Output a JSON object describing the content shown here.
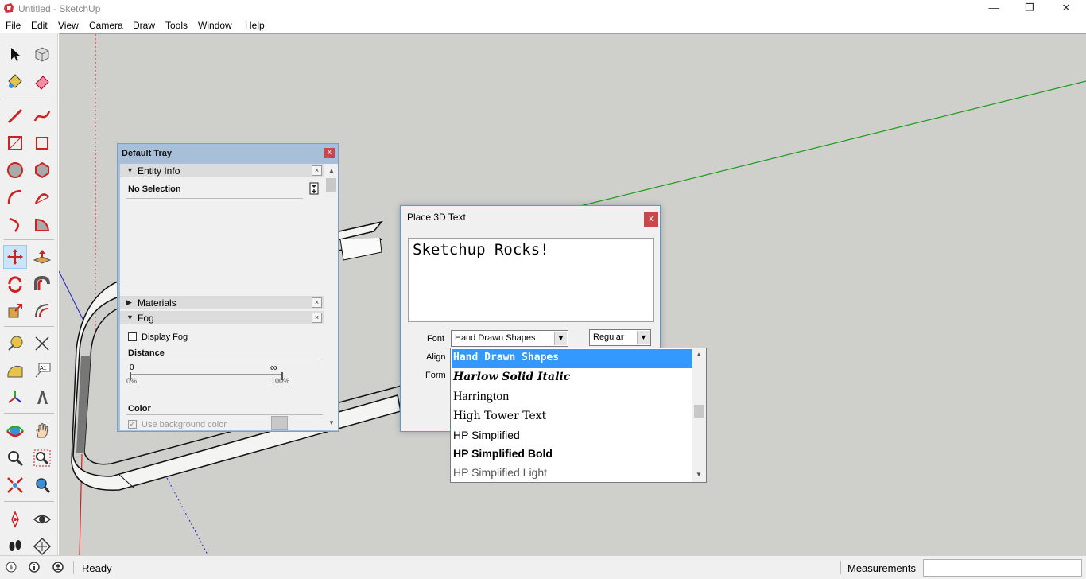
{
  "window": {
    "title": "Untitled - SketchUp",
    "minimize": "—",
    "restore": "❐",
    "close": "✕"
  },
  "menu": [
    "File",
    "Edit",
    "View",
    "Camera",
    "Draw",
    "Tools",
    "Window",
    "Help"
  ],
  "toolbar": {
    "tools": [
      "select",
      "make-component",
      "paint-bucket",
      "eraser",
      "line",
      "freehand",
      "rectangle",
      "rotated-rectangle",
      "circle",
      "polygon",
      "arc",
      "2-point-arc",
      "3-point-arc",
      "pie",
      "move",
      "push-pull",
      "rotate",
      "follow-me",
      "scale",
      "offset",
      "tape-measure",
      "dimension",
      "protractor",
      "text",
      "axes",
      "3d-text",
      "orbit",
      "pan",
      "zoom",
      "zoom-window",
      "zoom-extents",
      "previous-view",
      "position-camera",
      "look-around",
      "walk",
      "section-plane"
    ],
    "active": "move"
  },
  "tray": {
    "title": "Default Tray",
    "close": "x",
    "entity_info": {
      "label": "Entity Info",
      "selection": "No Selection"
    },
    "materials": {
      "label": "Materials"
    },
    "fog": {
      "label": "Fog",
      "display_fog": "Display Fog",
      "display_fog_checked": false,
      "distance_label": "Distance",
      "slider_start": "0",
      "slider_end": "∞",
      "pct_start": "0%",
      "pct_end": "100%",
      "color_label": "Color",
      "use_bg_color": "Use background color",
      "use_bg_color_checked": true
    },
    "collapse_arrow": "▼",
    "expand_arrow": "▶",
    "section_close": "×"
  },
  "dialog": {
    "title": "Place 3D Text",
    "close": "x",
    "text": "Sketchup Rocks!",
    "font_label": "Font",
    "font_value": "Hand Drawn Shapes",
    "style_value": "Regular",
    "align_label": "Align",
    "form_label": "Form"
  },
  "font_list": [
    "Hand Drawn Shapes",
    "Harlow Solid Italic",
    "Harrington",
    "High Tower Text",
    "HP Simplified",
    "HP Simplified Bold",
    "HP Simplified Light"
  ],
  "font_list_selected_index": 0,
  "status": {
    "text": "Ready",
    "measurements_label": "Measurements",
    "measurements_value": ""
  }
}
